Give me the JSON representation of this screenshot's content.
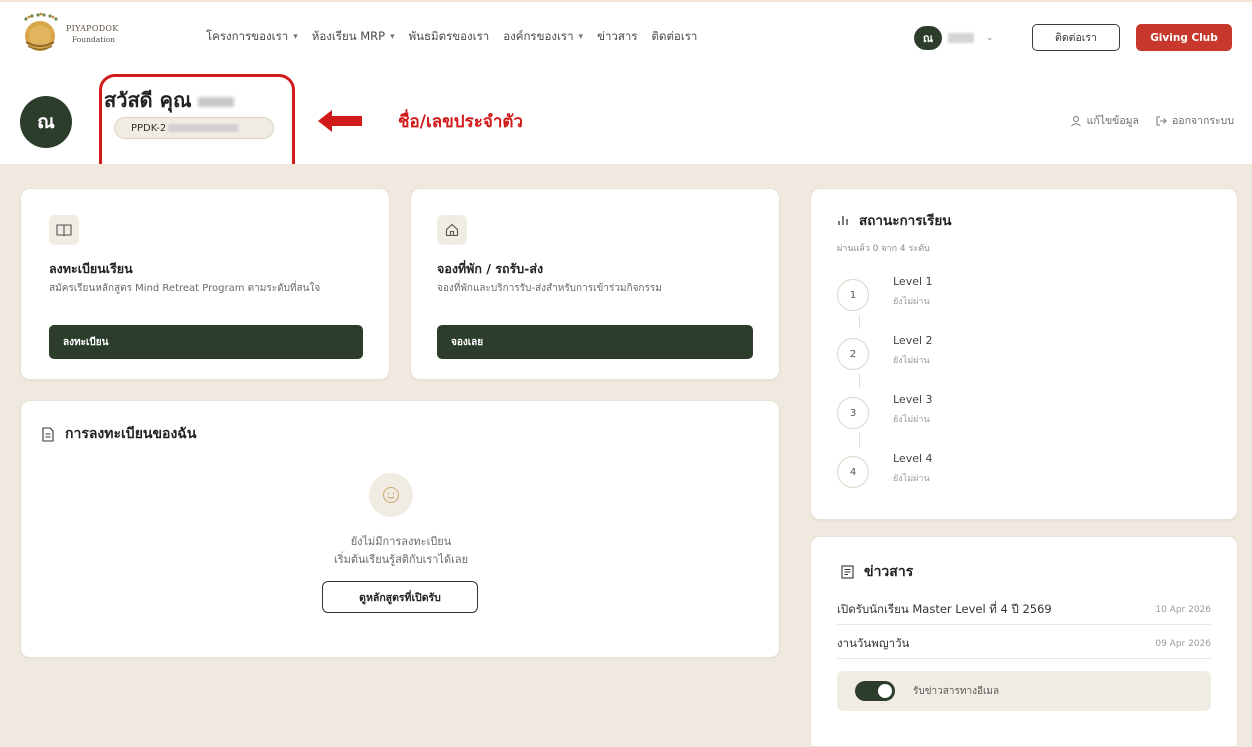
{
  "nav": {
    "logo_name": "PIYAPODOK",
    "logo_sub": "Foundation",
    "menu": [
      {
        "label": "โครงการของเรา",
        "dropdown": true
      },
      {
        "label": "ห้องเรียน MRP",
        "dropdown": true
      },
      {
        "label": "พันธมิตรของเรา",
        "dropdown": false
      },
      {
        "label": "องค์กรของเรา",
        "dropdown": true
      },
      {
        "label": "ข่าวสาร",
        "dropdown": false
      },
      {
        "label": "ติดต่อเรา",
        "dropdown": false
      }
    ],
    "user_initial": "ณ",
    "contact_button": "ติดต่อเรา",
    "giving_button": "Giving Club"
  },
  "header": {
    "avatar_initial": "ณ",
    "greeting": "สวัสดี คุณ",
    "member_id_prefix": "PPDK-2",
    "annotation": "ชื่อ/เลขประจำตัว",
    "edit_profile": "แก้ไขข้อมูล",
    "logout": "ออกจากระบบ"
  },
  "cards": {
    "register": {
      "title": "ลงทะเบียนเรียน",
      "desc": "สมัครเรียนหลักสูตร Mind Retreat Program ตามระดับที่สนใจ",
      "button": "ลงทะเบียน"
    },
    "booking": {
      "title": "จองที่พัก / รถรับ-ส่ง",
      "desc": "จองที่พักและบริการรับ-ส่งสำหรับการเข้าร่วมกิจกรรม",
      "button": "จองเลย"
    }
  },
  "my_registrations": {
    "title": "การลงทะเบียนของฉัน",
    "empty_line1": "ยังไม่มีการลงทะเบียน",
    "empty_line2": "เริ่มต้นเรียนรู้สติกับเราได้เลย",
    "button": "ดูหลักสูตรที่เปิดรับ"
  },
  "study_status": {
    "title": "สถานะการเรียน",
    "subtitle": "ผ่านแล้ว 0 จาก 4 ระดับ",
    "levels": [
      {
        "num": "1",
        "name": "Level 1",
        "status": "ยังไม่ผ่าน"
      },
      {
        "num": "2",
        "name": "Level 2",
        "status": "ยังไม่ผ่าน"
      },
      {
        "num": "3",
        "name": "Level 3",
        "status": "ยังไม่ผ่าน"
      },
      {
        "num": "4",
        "name": "Level 4",
        "status": "ยังไม่ผ่าน"
      }
    ]
  },
  "news": {
    "title": "ข่าวสาร",
    "items": [
      {
        "title": "เปิดรับนักเรียน Master Level ที่ 4 ปี 2569",
        "date": "10 Apr 2026"
      },
      {
        "title": "งานวันพญาวัน",
        "date": "09 Apr 2026"
      }
    ],
    "subscribe_label": "รับข่าวสารทางอีเมล",
    "subscribed": true
  }
}
